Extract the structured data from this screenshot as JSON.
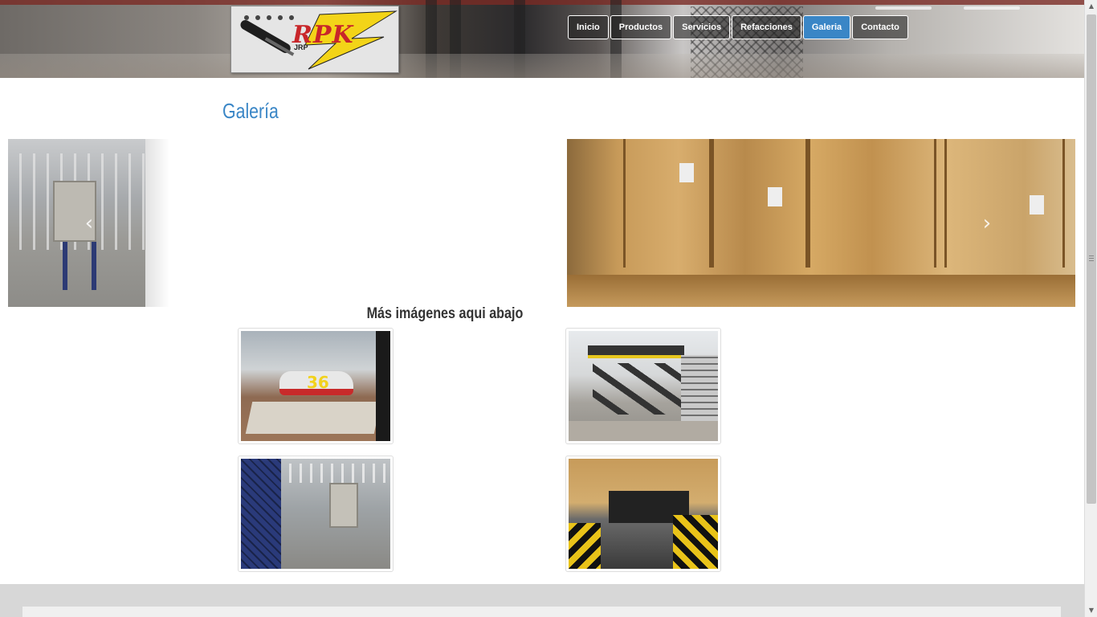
{
  "logo": {
    "text": "RPK",
    "subtext": "JRP"
  },
  "nav": {
    "items": [
      {
        "label": "Inicio",
        "active": false
      },
      {
        "label": "Productos",
        "active": false
      },
      {
        "label": "Servicios",
        "active": false
      },
      {
        "label": "Refacciones",
        "active": false
      },
      {
        "label": "Galeria",
        "active": true
      },
      {
        "label": "Contacto",
        "active": false
      }
    ]
  },
  "page": {
    "title": "Galería",
    "subtitle": "Más imágenes aqui abajo"
  },
  "carousel": {
    "prev_icon": "chevron-left-icon",
    "next_icon": "chevron-right-icon"
  },
  "colors": {
    "accent": "#3a86c6",
    "footer": "#d7d7d7"
  }
}
